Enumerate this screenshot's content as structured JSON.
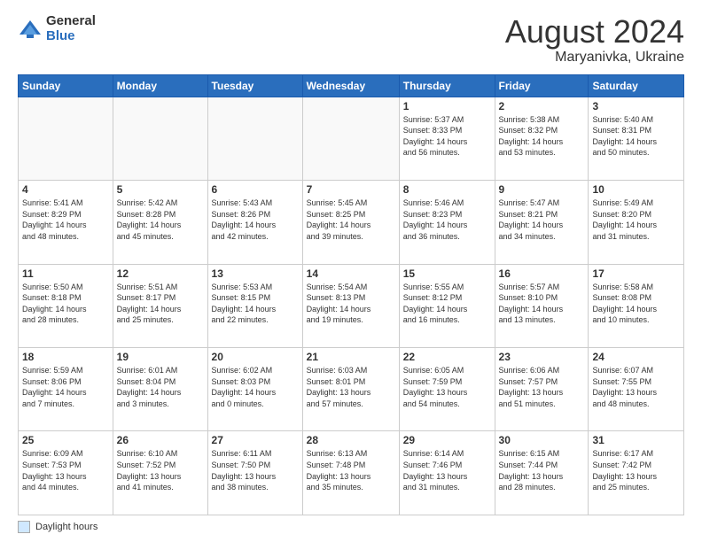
{
  "header": {
    "logo_general": "General",
    "logo_blue": "Blue",
    "month_year": "August 2024",
    "location": "Maryanivka, Ukraine"
  },
  "days_of_week": [
    "Sunday",
    "Monday",
    "Tuesday",
    "Wednesday",
    "Thursday",
    "Friday",
    "Saturday"
  ],
  "legend_label": "Daylight hours",
  "weeks": [
    [
      {
        "num": "",
        "detail": ""
      },
      {
        "num": "",
        "detail": ""
      },
      {
        "num": "",
        "detail": ""
      },
      {
        "num": "",
        "detail": ""
      },
      {
        "num": "1",
        "detail": "Sunrise: 5:37 AM\nSunset: 8:33 PM\nDaylight: 14 hours\nand 56 minutes."
      },
      {
        "num": "2",
        "detail": "Sunrise: 5:38 AM\nSunset: 8:32 PM\nDaylight: 14 hours\nand 53 minutes."
      },
      {
        "num": "3",
        "detail": "Sunrise: 5:40 AM\nSunset: 8:31 PM\nDaylight: 14 hours\nand 50 minutes."
      }
    ],
    [
      {
        "num": "4",
        "detail": "Sunrise: 5:41 AM\nSunset: 8:29 PM\nDaylight: 14 hours\nand 48 minutes."
      },
      {
        "num": "5",
        "detail": "Sunrise: 5:42 AM\nSunset: 8:28 PM\nDaylight: 14 hours\nand 45 minutes."
      },
      {
        "num": "6",
        "detail": "Sunrise: 5:43 AM\nSunset: 8:26 PM\nDaylight: 14 hours\nand 42 minutes."
      },
      {
        "num": "7",
        "detail": "Sunrise: 5:45 AM\nSunset: 8:25 PM\nDaylight: 14 hours\nand 39 minutes."
      },
      {
        "num": "8",
        "detail": "Sunrise: 5:46 AM\nSunset: 8:23 PM\nDaylight: 14 hours\nand 36 minutes."
      },
      {
        "num": "9",
        "detail": "Sunrise: 5:47 AM\nSunset: 8:21 PM\nDaylight: 14 hours\nand 34 minutes."
      },
      {
        "num": "10",
        "detail": "Sunrise: 5:49 AM\nSunset: 8:20 PM\nDaylight: 14 hours\nand 31 minutes."
      }
    ],
    [
      {
        "num": "11",
        "detail": "Sunrise: 5:50 AM\nSunset: 8:18 PM\nDaylight: 14 hours\nand 28 minutes."
      },
      {
        "num": "12",
        "detail": "Sunrise: 5:51 AM\nSunset: 8:17 PM\nDaylight: 14 hours\nand 25 minutes."
      },
      {
        "num": "13",
        "detail": "Sunrise: 5:53 AM\nSunset: 8:15 PM\nDaylight: 14 hours\nand 22 minutes."
      },
      {
        "num": "14",
        "detail": "Sunrise: 5:54 AM\nSunset: 8:13 PM\nDaylight: 14 hours\nand 19 minutes."
      },
      {
        "num": "15",
        "detail": "Sunrise: 5:55 AM\nSunset: 8:12 PM\nDaylight: 14 hours\nand 16 minutes."
      },
      {
        "num": "16",
        "detail": "Sunrise: 5:57 AM\nSunset: 8:10 PM\nDaylight: 14 hours\nand 13 minutes."
      },
      {
        "num": "17",
        "detail": "Sunrise: 5:58 AM\nSunset: 8:08 PM\nDaylight: 14 hours\nand 10 minutes."
      }
    ],
    [
      {
        "num": "18",
        "detail": "Sunrise: 5:59 AM\nSunset: 8:06 PM\nDaylight: 14 hours\nand 7 minutes."
      },
      {
        "num": "19",
        "detail": "Sunrise: 6:01 AM\nSunset: 8:04 PM\nDaylight: 14 hours\nand 3 minutes."
      },
      {
        "num": "20",
        "detail": "Sunrise: 6:02 AM\nSunset: 8:03 PM\nDaylight: 14 hours\nand 0 minutes."
      },
      {
        "num": "21",
        "detail": "Sunrise: 6:03 AM\nSunset: 8:01 PM\nDaylight: 13 hours\nand 57 minutes."
      },
      {
        "num": "22",
        "detail": "Sunrise: 6:05 AM\nSunset: 7:59 PM\nDaylight: 13 hours\nand 54 minutes."
      },
      {
        "num": "23",
        "detail": "Sunrise: 6:06 AM\nSunset: 7:57 PM\nDaylight: 13 hours\nand 51 minutes."
      },
      {
        "num": "24",
        "detail": "Sunrise: 6:07 AM\nSunset: 7:55 PM\nDaylight: 13 hours\nand 48 minutes."
      }
    ],
    [
      {
        "num": "25",
        "detail": "Sunrise: 6:09 AM\nSunset: 7:53 PM\nDaylight: 13 hours\nand 44 minutes."
      },
      {
        "num": "26",
        "detail": "Sunrise: 6:10 AM\nSunset: 7:52 PM\nDaylight: 13 hours\nand 41 minutes."
      },
      {
        "num": "27",
        "detail": "Sunrise: 6:11 AM\nSunset: 7:50 PM\nDaylight: 13 hours\nand 38 minutes."
      },
      {
        "num": "28",
        "detail": "Sunrise: 6:13 AM\nSunset: 7:48 PM\nDaylight: 13 hours\nand 35 minutes."
      },
      {
        "num": "29",
        "detail": "Sunrise: 6:14 AM\nSunset: 7:46 PM\nDaylight: 13 hours\nand 31 minutes."
      },
      {
        "num": "30",
        "detail": "Sunrise: 6:15 AM\nSunset: 7:44 PM\nDaylight: 13 hours\nand 28 minutes."
      },
      {
        "num": "31",
        "detail": "Sunrise: 6:17 AM\nSunset: 7:42 PM\nDaylight: 13 hours\nand 25 minutes."
      }
    ]
  ]
}
